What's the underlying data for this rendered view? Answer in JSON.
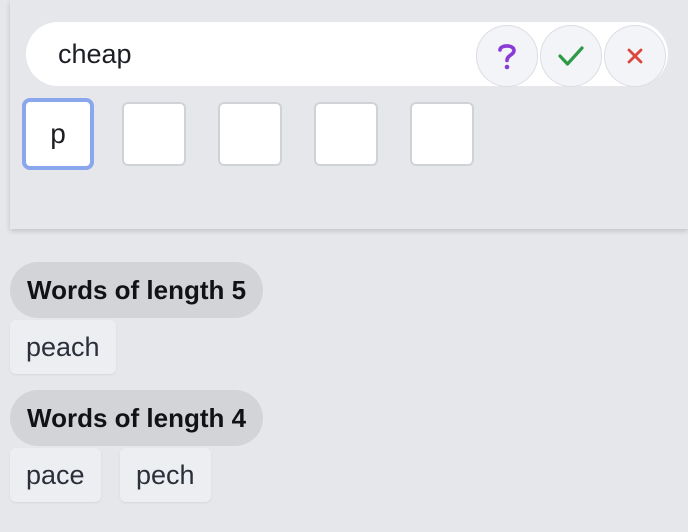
{
  "search": {
    "value": "cheap",
    "placeholder": ""
  },
  "buttons": {
    "help_icon": "question-mark",
    "ok_icon": "check-mark",
    "cancel_icon": "x-mark"
  },
  "letter_boxes": [
    "p",
    "",
    "",
    "",
    ""
  ],
  "groups": [
    {
      "title": "Words of length 5",
      "words": [
        "peach"
      ]
    },
    {
      "title": "Words of length 4",
      "words": [
        "pace",
        "pech"
      ]
    }
  ],
  "colors": {
    "help": "#8a3ad6",
    "ok": "#2f9a46",
    "cancel": "#d9473e",
    "focus": "#8aa7ee"
  }
}
